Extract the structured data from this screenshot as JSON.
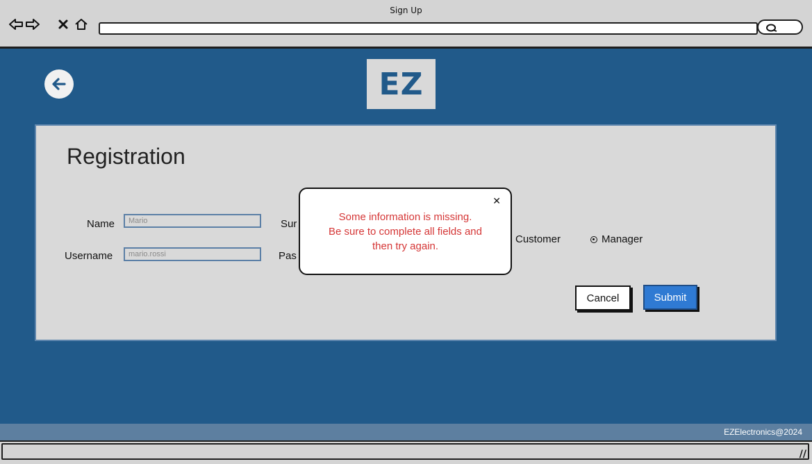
{
  "window": {
    "title": "Sign Up"
  },
  "logo": {
    "text": "EZ"
  },
  "registration": {
    "title": "Registration",
    "name_label": "Name",
    "name_value": "Mario",
    "surname_label_partial": "Sur",
    "username_label": "Username",
    "username_value": "mario.rossi",
    "password_label_partial": "Pas",
    "role_options": [
      {
        "label": "Customer",
        "selected": false
      },
      {
        "label": "Manager",
        "selected": true
      }
    ],
    "cancel_label": "Cancel",
    "submit_label": "Submit"
  },
  "modal": {
    "close_label": "✕",
    "line1": "Some information is missing.",
    "line2": "Be sure to complete all fields and",
    "line3": "then try again."
  },
  "footer": {
    "text": "EZElectronics@2024"
  },
  "colors": {
    "background": "#215a8a",
    "panel": "#d9d9d9",
    "submit": "#2f7ad3",
    "error_text": "#d53636"
  }
}
